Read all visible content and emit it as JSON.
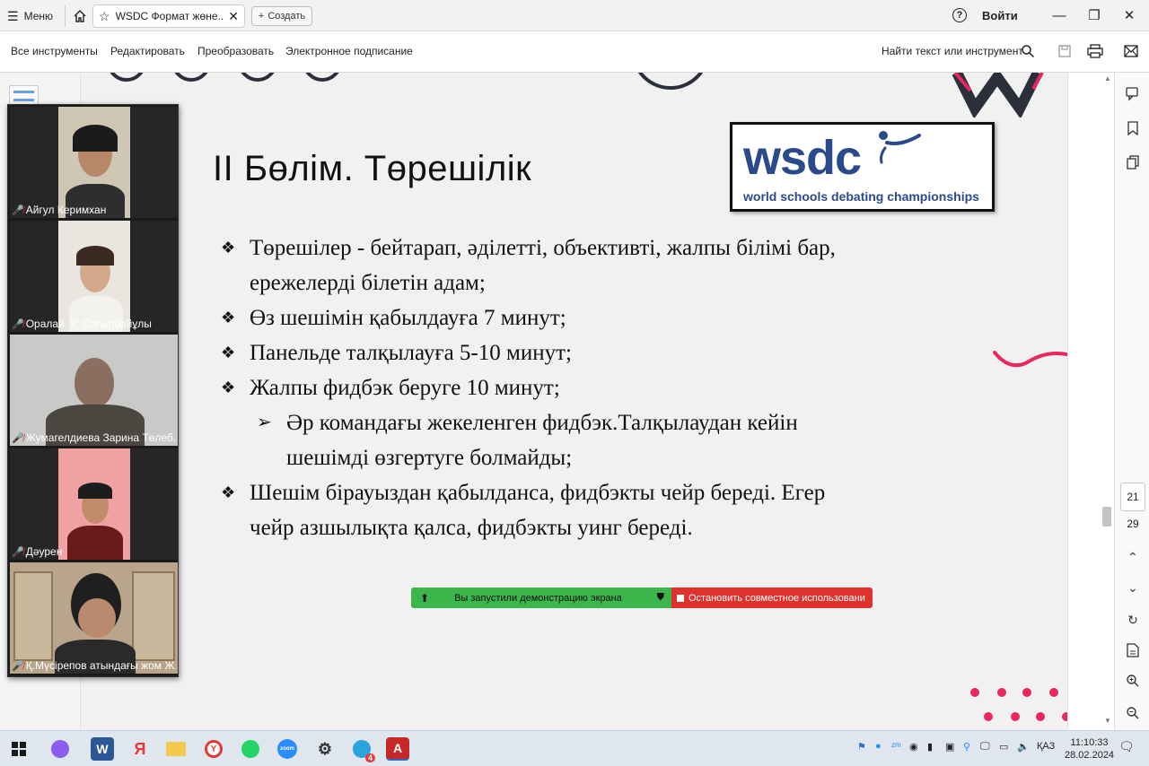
{
  "titlebar": {
    "menu_label": "Меню",
    "tab_title": "WSDC Формат жөне...",
    "new_tab_label": "Создать",
    "signin_label": "Войти"
  },
  "toolbar": {
    "items": [
      "Все инструменты",
      "Редактировать",
      "Преобразовать",
      "Электронное подписание"
    ],
    "find_label": "Найти текст или инструмент"
  },
  "slide": {
    "title": "II Бөлім. Төрешілік",
    "logo_main": "wsdc",
    "logo_sub": "world schools debating championships",
    "bullets": [
      "Төрешілер - бейтарап, әділетті, объективті, жалпы білімі бар, ережелерді білетін адам;",
      "Өз шешімін қабылдауға 7 минут;",
      "Панельде талқылауға 5-10 минут;",
      "Жалпы фидбэк беруге 10 минут;"
    ],
    "sub_bullet": "Әр командағы жекеленген фидбэк.Талқылаудан кейін шешімді өзгертуге болмайды;",
    "last_bullet": "Шешім бірауыздан қабылданса, фидбэкты чейр береді. Егер чейр азшылықта қалса, фидбэкты уинг береді."
  },
  "share_bar": {
    "status": "Вы запустили демонстрацию экрана",
    "stop": "Остановить совместное использовани"
  },
  "participants": [
    {
      "name": "Айгул Керимхан"
    },
    {
      "name": "Оралай. Қ. Сағырбайұлы"
    },
    {
      "name": "Жумагелдиева Зарина Төлеб..."
    },
    {
      "name": "Дәурен"
    },
    {
      "name": "Қ.Мүсірепов атындағы жом Ж..."
    }
  ],
  "pages": {
    "current": "21",
    "total": "29"
  },
  "taskbar": {
    "lang": "ҚАЗ",
    "time": "11:10:33",
    "date": "28.02.2024",
    "telegram_badge": "4"
  }
}
